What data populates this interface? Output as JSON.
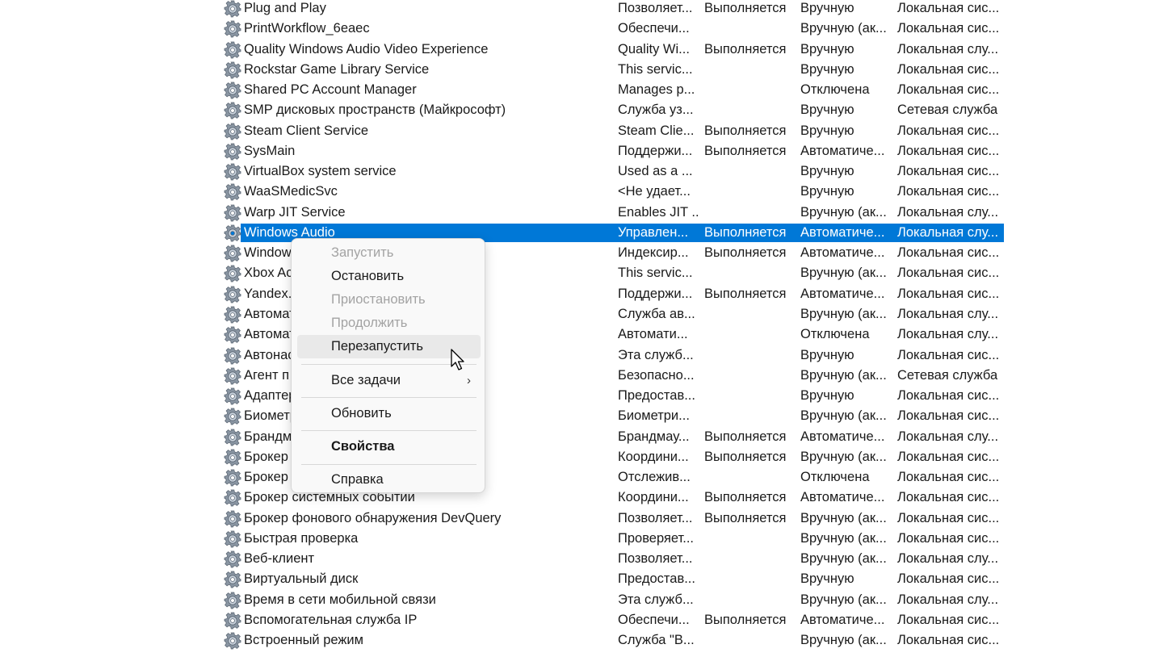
{
  "services": [
    {
      "name": "Plug and Play",
      "description": "Позволяет...",
      "status": "Выполняется",
      "startup": "Вручную",
      "logon": "Локальная сис..."
    },
    {
      "name": "PrintWorkflow_6eaec",
      "description": "Обеспечи...",
      "status": "",
      "startup": "Вручную (ак...",
      "logon": "Локальная сис..."
    },
    {
      "name": "Quality Windows Audio Video Experience",
      "description": "Quality Wi...",
      "status": "Выполняется",
      "startup": "Вручную",
      "logon": "Локальная слу..."
    },
    {
      "name": "Rockstar Game Library Service",
      "description": "This servic...",
      "status": "",
      "startup": "Вручную",
      "logon": "Локальная сис..."
    },
    {
      "name": "Shared PC Account Manager",
      "description": "Manages p...",
      "status": "",
      "startup": "Отключена",
      "logon": "Локальная сис..."
    },
    {
      "name": "SMP дисковых пространств (Майкрософт)",
      "description": "Служба уз...",
      "status": "",
      "startup": "Вручную",
      "logon": "Сетевая служба"
    },
    {
      "name": "Steam Client Service",
      "description": "Steam Clie...",
      "status": "Выполняется",
      "startup": "Вручную",
      "logon": "Локальная сис..."
    },
    {
      "name": "SysMain",
      "description": "Поддержи...",
      "status": "Выполняется",
      "startup": "Автоматиче...",
      "logon": "Локальная сис..."
    },
    {
      "name": "VirtualBox system service",
      "description": "Used as a ...",
      "status": "",
      "startup": "Вручную",
      "logon": "Локальная сис..."
    },
    {
      "name": "WaaSMedicSvc",
      "description": "<Не удает...",
      "status": "",
      "startup": "Вручную",
      "logon": "Локальная сис..."
    },
    {
      "name": "Warp JIT Service",
      "description": "Enables JIT ...",
      "status": "",
      "startup": "Вручную (ак...",
      "logon": "Локальная слу..."
    },
    {
      "name": "Windows Audio",
      "description": "Управлен...",
      "status": "Выполняется",
      "startup": "Автоматиче...",
      "logon": "Локальная слу..."
    },
    {
      "name": "Window",
      "description": "Индексир...",
      "status": "Выполняется",
      "startup": "Автоматиче...",
      "logon": "Локальная сис..."
    },
    {
      "name": "Xbox Ac",
      "description": "This servic...",
      "status": "",
      "startup": "Вручную (ак...",
      "logon": "Локальная сис..."
    },
    {
      "name": "Yandex.I",
      "description": "Поддержи...",
      "status": "Выполняется",
      "startup": "Автоматиче...",
      "logon": "Локальная сис..."
    },
    {
      "name": "Автомат                                         ройств",
      "description": "Служба ав...",
      "status": "",
      "startup": "Вручную (ак...",
      "logon": "Локальная слу..."
    },
    {
      "name": "Автомат                                         ояса",
      "description": "Автомати...",
      "status": "",
      "startup": "Отключена",
      "logon": "Локальная слу..."
    },
    {
      "name": "Автонас",
      "description": "Эта служб...",
      "status": "",
      "startup": "Вручную",
      "logon": "Локальная сис..."
    },
    {
      "name": "Агент п",
      "description": "Безопасно...",
      "status": "",
      "startup": "Вручную (ак...",
      "logon": "Сетевая служба"
    },
    {
      "name": "Адаптер",
      "description": "Предостав...",
      "status": "",
      "startup": "Вручную",
      "logon": "Локальная сис..."
    },
    {
      "name": "Биометр",
      "description": "Биометри...",
      "status": "",
      "startup": "Вручную (ак...",
      "logon": "Локальная сис..."
    },
    {
      "name": "Брандм",
      "description": "Брандмау...",
      "status": "Выполняется",
      "startup": "Автоматиче...",
      "logon": "Локальная слу..."
    },
    {
      "name": "Брокер",
      "description": "Координи...",
      "status": "Выполняется",
      "startup": "Вручную (ак...",
      "logon": "Локальная сис..."
    },
    {
      "name": "Брокер                                              System Guard",
      "description": "Отслежив...",
      "status": "",
      "startup": "Отключена",
      "logon": "Локальная сис..."
    },
    {
      "name": "Брокер системных событий",
      "description": "Координи...",
      "status": "Выполняется",
      "startup": "Автоматиче...",
      "logon": "Локальная сис..."
    },
    {
      "name": "Брокер фонового обнаружения DevQuery",
      "description": "Позволяет...",
      "status": "Выполняется",
      "startup": "Вручную (ак...",
      "logon": "Локальная сис..."
    },
    {
      "name": "Быстрая проверка",
      "description": "Проверяет...",
      "status": "",
      "startup": "Вручную (ак...",
      "logon": "Локальная сис..."
    },
    {
      "name": "Веб-клиент",
      "description": "Позволяет...",
      "status": "",
      "startup": "Вручную (ак...",
      "logon": "Локальная слу..."
    },
    {
      "name": "Виртуальный диск",
      "description": "Предостав...",
      "status": "",
      "startup": "Вручную",
      "logon": "Локальная сис..."
    },
    {
      "name": "Время в сети мобильной связи",
      "description": "Эта служб...",
      "status": "",
      "startup": "Вручную (ак...",
      "logon": "Локальная слу..."
    },
    {
      "name": "Вспомогательная служба IP",
      "description": "Обеспечи...",
      "status": "Выполняется",
      "startup": "Автоматиче...",
      "logon": "Локальная сис..."
    },
    {
      "name": "Встроенный режим",
      "description": "Служба \"В...",
      "status": "",
      "startup": "Вручную (ак...",
      "logon": "Локальная сис..."
    }
  ],
  "selected_service": "Windows Audio",
  "context_menu": {
    "start": "Запустить",
    "stop": "Остановить",
    "pause": "Приостановить",
    "resume": "Продолжить",
    "restart": "Перезапустить",
    "all_tasks": "Все задачи",
    "refresh": "Обновить",
    "properties": "Свойства",
    "help": "Справка"
  },
  "colors": {
    "selection": "#0078d7",
    "menu_background": "#f9f9f9",
    "disabled_text": "#a3a3a3"
  }
}
